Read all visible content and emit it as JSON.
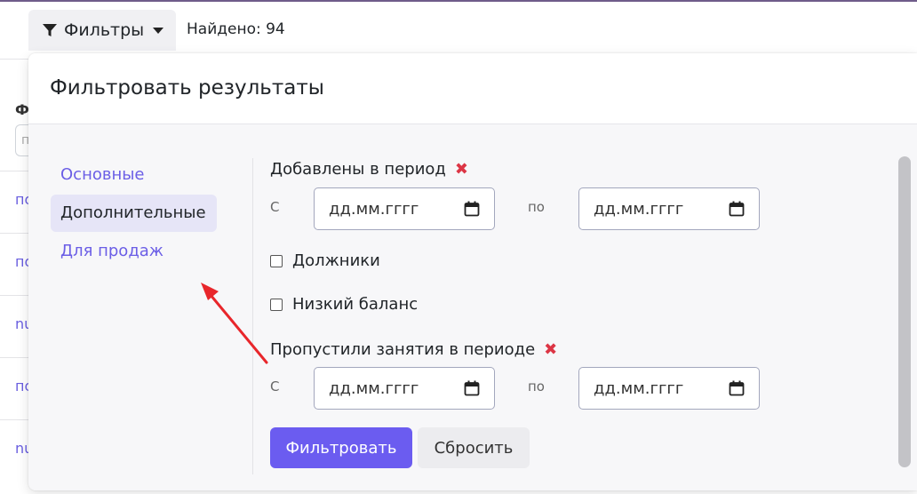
{
  "toolbar": {
    "filters_label": "Фильтры",
    "found_text": "Найдено: 94"
  },
  "background": {
    "header_fragment": "Ф",
    "input_fragment": "п",
    "rows": [
      "по",
      "по",
      "nu",
      "по",
      "nu"
    ]
  },
  "panel": {
    "title": "Фильтровать результаты",
    "tabs": [
      {
        "label": "Основные",
        "active": false
      },
      {
        "label": "Дополнительные",
        "active": true
      },
      {
        "label": "Для продаж",
        "active": false
      }
    ],
    "added_period": {
      "label": "Добавлены в период",
      "clear": "✖",
      "from_label": "С",
      "to_label": "по",
      "from_value": "дд.мм.гггг",
      "to_value": "дд.мм.гггг"
    },
    "debtors_label": "Должники",
    "low_balance_label": "Низкий баланс",
    "missed_period": {
      "label": "Пропустили занятия в периоде",
      "clear": "✖",
      "from_label": "С",
      "to_label": "по",
      "from_value": "дд.мм.гггг",
      "to_value": "дд.мм.гггг"
    },
    "filter_button": "Фильтровать",
    "reset_button": "Сбросить"
  },
  "colors": {
    "accent": "#6b5cf0",
    "link": "#6b5ee6",
    "danger": "#dc3545",
    "annotation_arrow": "#e8262b"
  }
}
